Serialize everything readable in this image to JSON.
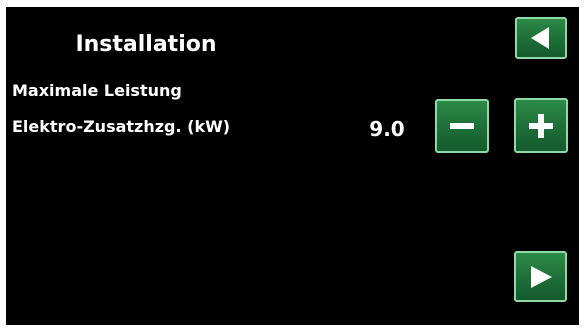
{
  "screen": {
    "title": "Installation",
    "setting": {
      "label_line1": "Maximale Leistung",
      "label_line2": "Elektro-Zusatzhzg. (kW)",
      "value": "9.0"
    }
  },
  "buttons": {
    "back_icon": "triangle-left-icon",
    "decrease_icon": "minus-icon",
    "increase_icon": "plus-icon",
    "next_icon": "triangle-right-icon"
  },
  "colors": {
    "background": "#000000",
    "text": "#ffffff",
    "button_fill": "#1d6e37",
    "button_border": "#8fd9a6",
    "icon": "#ffffff"
  }
}
